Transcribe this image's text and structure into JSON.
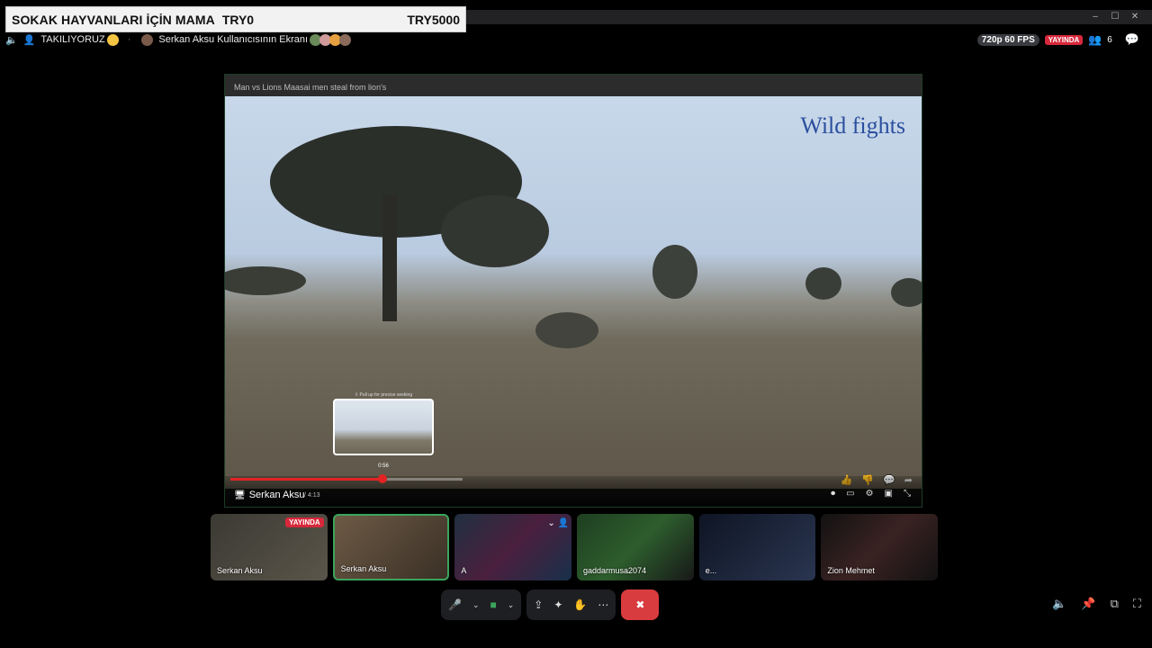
{
  "banner": {
    "title": "SOKAK HAYVANLARI İÇİN MAMA",
    "amount": "TRY0",
    "goal": "TRY5000"
  },
  "window_controls": {
    "minimize": "–",
    "maximize": "☐",
    "close": "✕"
  },
  "topbar": {
    "status_text": "TAKILIYORUZ",
    "channel_text": "Serkan Aksu Kullanıcısının Ekranı",
    "quality": "720p 60 FPS",
    "live_label": "YAYINDA",
    "viewer_count": "6"
  },
  "stream": {
    "video_title": "Man vs Lions  Maasai men steal from lion's",
    "overlay_text": "Wild fights",
    "seek_hint": "⇧ Pull up for precise seeking",
    "preview_time": "0:56",
    "progress_fraction": 0.22,
    "sharer_label": "Serkan Aksu",
    "duration": "/ 4:13"
  },
  "tiles": [
    {
      "name": "Serkan Aksu",
      "live": "YAYINDA",
      "selected": false
    },
    {
      "name": "Serkan Aksu",
      "live": "",
      "selected": true
    },
    {
      "name": "A",
      "live": "",
      "selected": false
    },
    {
      "name": "gaddarmusa2074",
      "live": "",
      "selected": false
    },
    {
      "name": "e...",
      "live": "",
      "selected": false
    },
    {
      "name": "Zion Mehmet",
      "live": "",
      "selected": false
    }
  ],
  "colors": {
    "live_red": "#d7283b",
    "accent_green": "#3ba55c",
    "end_call_red": "#d83c3e"
  }
}
